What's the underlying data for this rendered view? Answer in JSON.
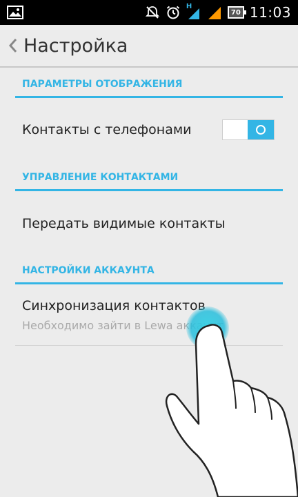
{
  "status_bar": {
    "icons": [
      "image-icon",
      "muted-icon",
      "alarm-icon",
      "signal-h-icon",
      "signal-icon",
      "battery-icon"
    ],
    "network_label": "H",
    "battery_level": "70",
    "time": "11:03"
  },
  "action_bar": {
    "title": "Настройка",
    "back_icon": "chevron-left-icon"
  },
  "sections": [
    {
      "header": "ПАРАМЕТРЫ ОТОБРАЖЕНИЯ",
      "items": [
        {
          "title": "Контакты с телефонами",
          "toggle_on": true
        }
      ]
    },
    {
      "header": "УПРАВЛЕНИЕ КОНТАКТАМИ",
      "items": [
        {
          "title": "Передать видимые контакты"
        }
      ]
    },
    {
      "header": "НАСТРОЙКИ АККАУНТА",
      "items": [
        {
          "title": "Синхронизация контактов",
          "summary": "Необходимо зайти в Lewa аккаунт"
        }
      ]
    }
  ],
  "colors": {
    "accent": "#33b5e5",
    "background": "#ececec",
    "status_bar": "#000000",
    "touch_indicator": "#33d2e6"
  }
}
